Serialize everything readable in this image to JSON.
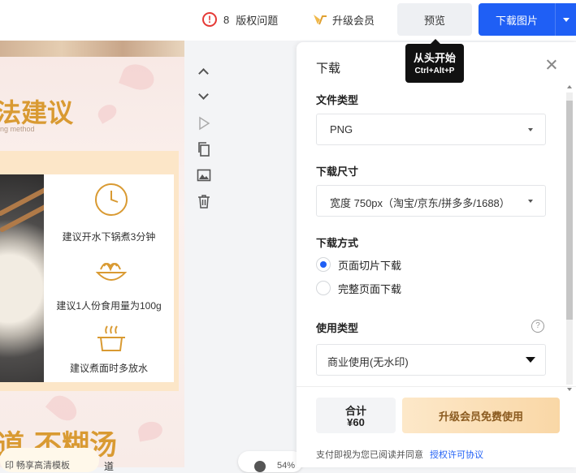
{
  "header": {
    "issues_count": "8",
    "issues_label": "版权问题",
    "vip_label": "升级会员",
    "preview_label": "预览",
    "download_label": "下载图片"
  },
  "tooltip": {
    "title": "从头开始",
    "shortcut": "Ctrl+Alt+P"
  },
  "design": {
    "headline_top": "法建议",
    "subtitle": "ng method",
    "tips": [
      "建议开水下锅煮3分钟",
      "建议1人份食用量为100g",
      "建议煮面时多放水"
    ],
    "headline_bottom": "道 不糊汤",
    "pill_text": "印 畅享高清模板",
    "small_text": "道"
  },
  "zoom": {
    "value": "54%"
  },
  "panel": {
    "title": "下载",
    "file_type": {
      "label": "文件类型",
      "value": "PNG"
    },
    "size": {
      "label": "下载尺寸",
      "value": "宽度 750px（淘宝/京东/拼多多/1688）"
    },
    "method": {
      "label": "下载方式",
      "options": [
        "页面切片下载",
        "完整页面下载"
      ],
      "selected": 0
    },
    "usage": {
      "label": "使用类型",
      "value": "商业使用(无水印)"
    },
    "total_label": "合计",
    "total_price": "¥60",
    "upgrade_label": "升级会员免费使用",
    "agree_text": "支付即视为您已阅读并同意",
    "agree_link": "授权许可协议"
  },
  "colors": {
    "accent": "#1f5ff5",
    "gold": "#d99a32",
    "warning": "#e53935"
  }
}
